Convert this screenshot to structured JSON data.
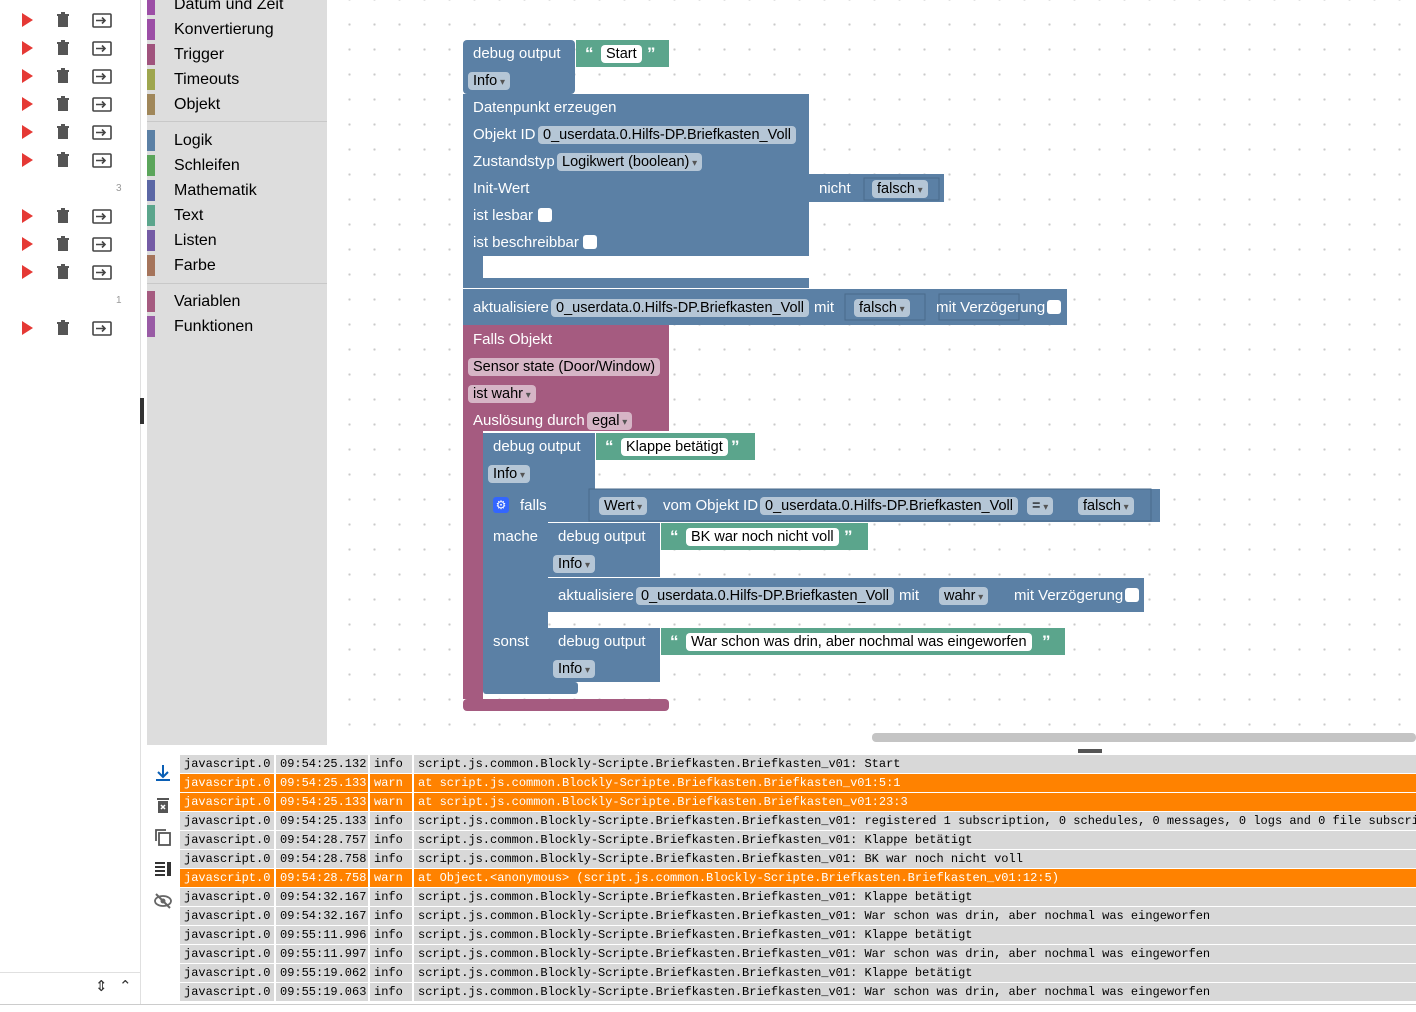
{
  "scripts_list": {
    "group_counts": [
      "3",
      "1"
    ]
  },
  "toolbox": {
    "categories": [
      {
        "label": "Datum und Zeit",
        "color": "#9c4ea6"
      },
      {
        "label": "Konvertierung",
        "color": "#9c4ea6"
      },
      {
        "label": "Trigger",
        "color": "#a0537d"
      },
      {
        "label": "Timeouts",
        "color": "#9ea64e"
      },
      {
        "label": "Objekt",
        "color": "#a0875a"
      },
      {
        "label": "Logik",
        "color": "#5b80a5"
      },
      {
        "label": "Schleifen",
        "color": "#5ba55b"
      },
      {
        "label": "Mathematik",
        "color": "#5b67a5"
      },
      {
        "label": "Text",
        "color": "#5ba58c"
      },
      {
        "label": "Listen",
        "color": "#745ba5"
      },
      {
        "label": "Farbe",
        "color": "#a5745b"
      },
      {
        "label": "Variablen",
        "color": "#a55b80"
      },
      {
        "label": "Funktionen",
        "color": "#995ba5"
      }
    ]
  },
  "workspace": {
    "colors": {
      "system": "#5b80a5",
      "trigger": "#a55b80",
      "text": "#5ba58c"
    },
    "debug1": {
      "label": "debug output",
      "text": "Start",
      "level": "Info"
    },
    "create_dp": {
      "title": "Datenpunkt erzeugen",
      "objid_label": "Objekt ID",
      "objid": "0_userdata.0.Hilfs-DP.Briefkasten_Voll",
      "type_label": "Zustandstyp",
      "type": "Logikwert (boolean)",
      "init_label": "Init-Wert",
      "not_label": "nicht",
      "init_value": "falsch",
      "readable_label": "ist lesbar",
      "writable_label": "ist beschreibbar"
    },
    "update1": {
      "label": "aktualisiere",
      "objid": "0_userdata.0.Hilfs-DP.Briefkasten_Voll",
      "with": "mit",
      "value": "falsch",
      "delay_label": "mit Verzögerung"
    },
    "on_obj": {
      "title": "Falls Objekt",
      "sensor": "Sensor state (Door/Window)",
      "cond": "ist wahr",
      "trigger_label": "Auslösung durch",
      "trigger": "egal"
    },
    "debug2": {
      "label": "debug output",
      "text": "Klappe betätigt",
      "level": "Info"
    },
    "if_block": {
      "if_label": "falls",
      "value_sel": "Wert",
      "from_label": "vom Objekt ID",
      "objid": "0_userdata.0.Hilfs-DP.Briefkasten_Voll",
      "op": "=",
      "compare": "falsch",
      "do_label": "mache",
      "else_label": "sonst"
    },
    "debug3": {
      "label": "debug output",
      "text": "BK war noch nicht voll",
      "level": "Info"
    },
    "update2": {
      "label": "aktualisiere",
      "objid": "0_userdata.0.Hilfs-DP.Briefkasten_Voll",
      "with": "mit",
      "value": "wahr",
      "delay_label": "mit Verzögerung"
    },
    "debug4": {
      "label": "debug output",
      "text": "War schon was drin, aber nochmal was eingeworfen",
      "level": "Info"
    }
  },
  "log": {
    "rows": [
      {
        "src": "javascript.0",
        "time": "09:54:25.132",
        "level": "info",
        "msg": "script.js.common.Blockly-Scripte.Briefkasten.Briefkasten_v01: Start"
      },
      {
        "src": "javascript.0",
        "time": "09:54:25.133",
        "level": "warn",
        "msg": "at script.js.common.Blockly-Scripte.Briefkasten.Briefkasten_v01:5:1"
      },
      {
        "src": "javascript.0",
        "time": "09:54:25.133",
        "level": "warn",
        "msg": "at script.js.common.Blockly-Scripte.Briefkasten.Briefkasten_v01:23:3"
      },
      {
        "src": "javascript.0",
        "time": "09:54:25.133",
        "level": "info",
        "msg": "script.js.common.Blockly-Scripte.Briefkasten.Briefkasten_v01: registered 1 subscription, 0 schedules, 0 messages, 0 logs and 0 file subscriptio"
      },
      {
        "src": "javascript.0",
        "time": "09:54:28.757",
        "level": "info",
        "msg": "script.js.common.Blockly-Scripte.Briefkasten.Briefkasten_v01: Klappe betätigt"
      },
      {
        "src": "javascript.0",
        "time": "09:54:28.758",
        "level": "info",
        "msg": "script.js.common.Blockly-Scripte.Briefkasten.Briefkasten_v01: BK war noch nicht voll"
      },
      {
        "src": "javascript.0",
        "time": "09:54:28.758",
        "level": "warn",
        "msg": "at Object.<anonymous> (script.js.common.Blockly-Scripte.Briefkasten.Briefkasten_v01:12:5)"
      },
      {
        "src": "javascript.0",
        "time": "09:54:32.167",
        "level": "info",
        "msg": "script.js.common.Blockly-Scripte.Briefkasten.Briefkasten_v01: Klappe betätigt"
      },
      {
        "src": "javascript.0",
        "time": "09:54:32.167",
        "level": "info",
        "msg": "script.js.common.Blockly-Scripte.Briefkasten.Briefkasten_v01: War schon was drin, aber nochmal was eingeworfen"
      },
      {
        "src": "javascript.0",
        "time": "09:55:11.996",
        "level": "info",
        "msg": "script.js.common.Blockly-Scripte.Briefkasten.Briefkasten_v01: Klappe betätigt"
      },
      {
        "src": "javascript.0",
        "time": "09:55:11.997",
        "level": "info",
        "msg": "script.js.common.Blockly-Scripte.Briefkasten.Briefkasten_v01: War schon was drin, aber nochmal was eingeworfen"
      },
      {
        "src": "javascript.0",
        "time": "09:55:19.062",
        "level": "info",
        "msg": "script.js.common.Blockly-Scripte.Briefkasten.Briefkasten_v01: Klappe betätigt"
      },
      {
        "src": "javascript.0",
        "time": "09:55:19.063",
        "level": "info",
        "msg": "script.js.common.Blockly-Scripte.Briefkasten.Briefkasten_v01: War schon was drin, aber nochmal was eingeworfen"
      }
    ]
  }
}
